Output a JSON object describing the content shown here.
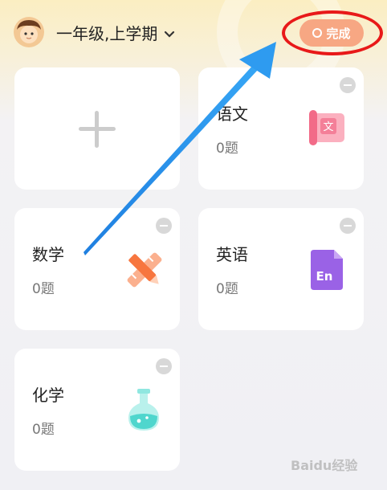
{
  "header": {
    "grade_selector": "一年级,上学期",
    "done_label": "完成"
  },
  "subjects": [
    {
      "name": "语文",
      "count": "0题",
      "icon_text": "文"
    },
    {
      "name": "数学",
      "count": "0题"
    },
    {
      "name": "英语",
      "count": "0题",
      "icon_text": "En"
    },
    {
      "name": "化学",
      "count": "0题"
    }
  ],
  "colors": {
    "done_button": "#f7a783",
    "callout_ring": "#e81919",
    "callout_arrow": "#1e90e8",
    "chinese_icon": "#f6819a",
    "math_icon": "#f78a5c",
    "english_icon": "#9a62e6",
    "chemistry_icon": "#53d8d1"
  },
  "icons": {
    "add": "plus-icon",
    "remove": "minus-circle-icon",
    "dropdown": "chevron-down-icon",
    "chinese": "scroll-book-icon",
    "math": "ruler-pencil-icon",
    "english": "en-book-icon",
    "chemistry": "flask-icon"
  },
  "watermark": "Baidu经验"
}
